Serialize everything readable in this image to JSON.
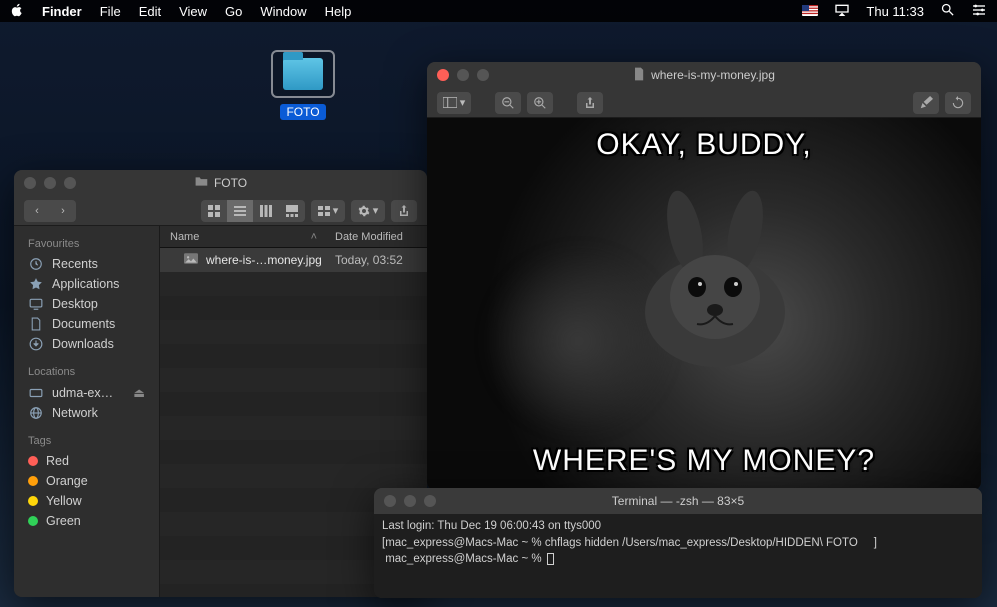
{
  "menubar": {
    "app_name": "Finder",
    "items": [
      "File",
      "Edit",
      "View",
      "Go",
      "Window",
      "Help"
    ],
    "clock": "Thu 11:33"
  },
  "desktop": {
    "folder_label": "FOTO"
  },
  "finder": {
    "window_title": "FOTO",
    "nav_back": "‹",
    "nav_fwd": "›",
    "columns": {
      "name": "Name",
      "date": "Date Modified"
    },
    "sidebar": {
      "favourites_head": "Favourites",
      "favourites": [
        "Recents",
        "Applications",
        "Desktop",
        "Documents",
        "Downloads"
      ],
      "locations_head": "Locations",
      "locations": [
        "udma-ex…",
        "Network"
      ],
      "tags_head": "Tags",
      "tags": [
        {
          "label": "Red",
          "color": "#ff5f57"
        },
        {
          "label": "Orange",
          "color": "#ff9f0a"
        },
        {
          "label": "Yellow",
          "color": "#ffd60a"
        },
        {
          "label": "Green",
          "color": "#30d158"
        }
      ]
    },
    "files": [
      {
        "name": "where-is-…money.jpg",
        "date": "Today, 03:52"
      }
    ]
  },
  "preview": {
    "file_title": "where-is-my-money.jpg",
    "meme_top": "OKAY, BUDDY,",
    "meme_bottom": "WHERE'S MY MONEY?"
  },
  "terminal": {
    "window_title": "Terminal — -zsh — 83×5",
    "line1": "Last login: Thu Dec 19 06:00:43 on ttys000",
    "line2_text": "[mac_express@Macs-Mac ~ % chflags hidden /Users/mac_express/Desktop/HIDDEN\\ FOTO     ]",
    "prompt": " mac_express@Macs-Mac ~ % "
  }
}
